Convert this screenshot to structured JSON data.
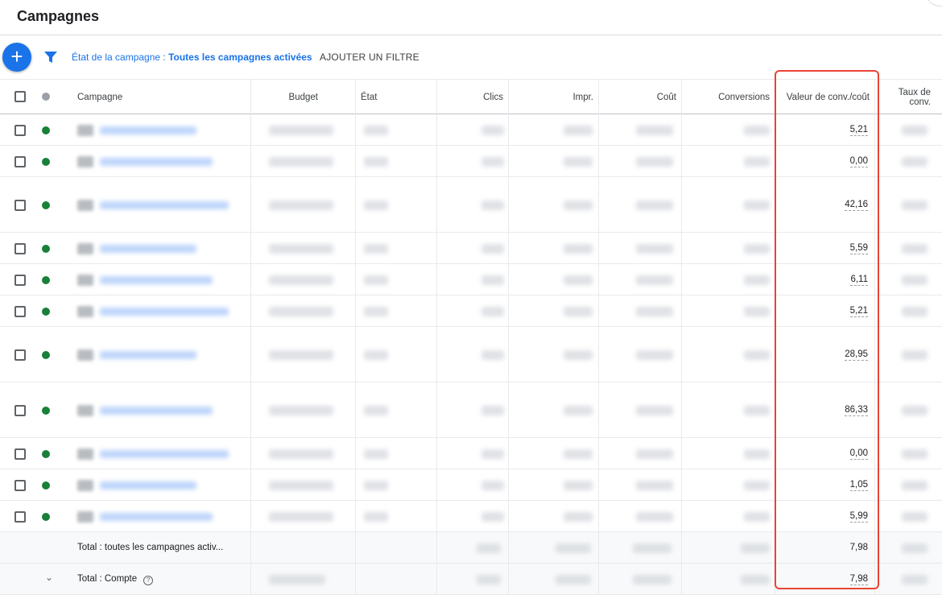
{
  "page": {
    "title": "Campagnes"
  },
  "toolbar": {
    "add_label": "+",
    "filter_prefix": "État de la campagne : ",
    "filter_value": "Toutes les campagnes activées",
    "add_filter_label": "AJOUTER UN FILTRE"
  },
  "table": {
    "columns": {
      "campagne": "Campagne",
      "budget": "Budget",
      "etat": "État",
      "clics": "Clics",
      "impr": "Impr.",
      "cout": "Coût",
      "conversions": "Conversions",
      "valeur": "Valeur de conv./coût",
      "taux_line1": "Taux de",
      "taux_line2": "conv."
    },
    "rows": [
      {
        "status": "enabled",
        "valeur": "5,21"
      },
      {
        "status": "enabled",
        "valeur": "0,00"
      },
      {
        "status": "enabled",
        "valeur": "42,16"
      },
      {
        "status": "enabled",
        "valeur": "5,59"
      },
      {
        "status": "enabled",
        "valeur": "6,11"
      },
      {
        "status": "enabled",
        "valeur": "5,21"
      },
      {
        "status": "enabled",
        "valeur": "28,95"
      },
      {
        "status": "enabled",
        "valeur": "86,33"
      },
      {
        "status": "enabled",
        "valeur": "0,00"
      },
      {
        "status": "enabled",
        "valeur": "1,05"
      },
      {
        "status": "enabled",
        "valeur": "5,99"
      }
    ],
    "totals": [
      {
        "label": "Total : toutes les campagnes activ...",
        "valeur": "7,98"
      },
      {
        "label": "Total : Compte",
        "help_icon": "help-circle-icon",
        "expand_icon": "chevron-down-icon",
        "valeur": "7,98"
      }
    ]
  },
  "colors": {
    "accent": "#1a73e8",
    "status_enabled": "#188038",
    "highlight": "#ea4335"
  }
}
